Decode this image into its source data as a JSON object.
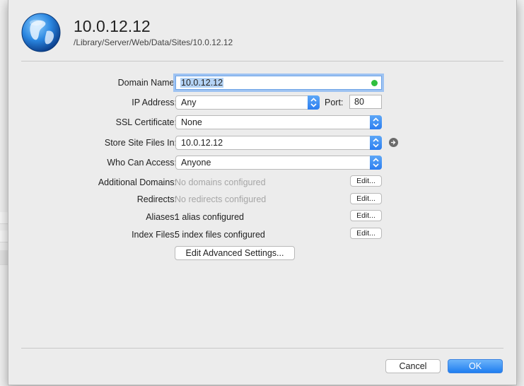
{
  "site": {
    "title": "10.0.12.12",
    "path": "/Library/Server/Web/Data/Sites/10.0.12.12"
  },
  "form": {
    "domain_name": {
      "label": "Domain Name:",
      "value": "10.0.12.12",
      "status_color": "#2fbf3d"
    },
    "ip_address": {
      "label": "IP Address:",
      "value": "Any"
    },
    "port": {
      "label": "Port:",
      "value": "80"
    },
    "ssl_certificate": {
      "label": "SSL Certificate:",
      "value": "None"
    },
    "store_site_files": {
      "label": "Store Site Files In:",
      "value": "10.0.12.12"
    },
    "who_can_access": {
      "label": "Who Can Access:",
      "value": "Anyone"
    },
    "additional_domains": {
      "label": "Additional Domains:",
      "value": "No domains configured",
      "button": "Edit..."
    },
    "redirects": {
      "label": "Redirects:",
      "value": "No redirects configured",
      "button": "Edit..."
    },
    "aliases": {
      "label": "Aliases:",
      "value": "1 alias configured",
      "button": "Edit..."
    },
    "index_files": {
      "label": "Index Files:",
      "value": "5 index files configured",
      "button": "Edit..."
    },
    "advanced_button": "Edit Advanced Settings..."
  },
  "footer": {
    "cancel_label": "Cancel",
    "ok_label": "OK"
  },
  "colors": {
    "accent": "#1f7ef0",
    "status_green": "#2fbf3d"
  }
}
